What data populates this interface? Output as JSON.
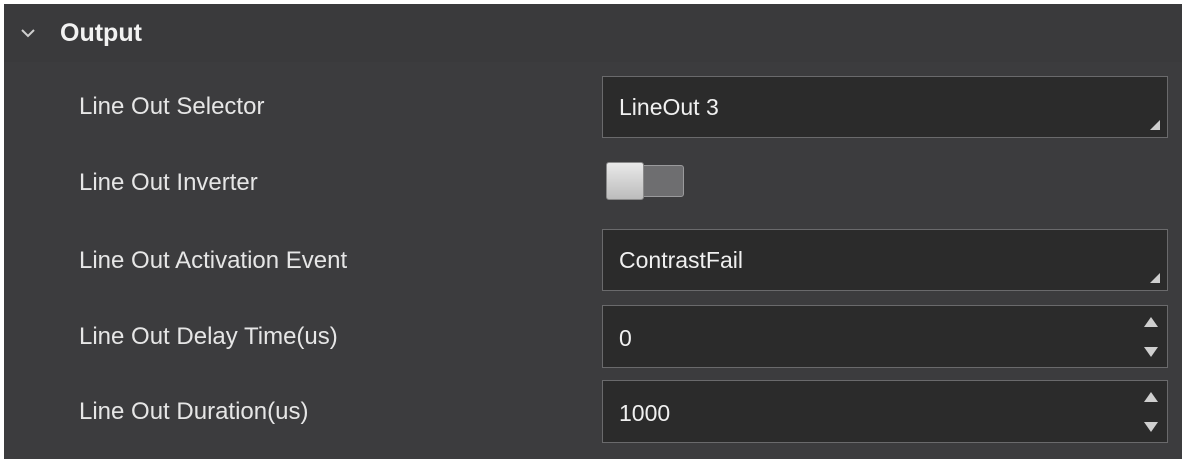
{
  "section": {
    "title": "Output",
    "expanded": true
  },
  "rows": {
    "line_out_selector": {
      "label": "Line Out Selector",
      "value": "LineOut 3"
    },
    "line_out_inverter": {
      "label": "Line Out Inverter",
      "on": false
    },
    "line_out_activation_event": {
      "label": "Line Out Activation Event",
      "value": "ContrastFail"
    },
    "line_out_delay_time": {
      "label": "Line Out Delay Time(us)",
      "value": "0"
    },
    "line_out_duration": {
      "label": "Line Out Duration(us)",
      "value": "1000"
    }
  },
  "colors": {
    "panel_bg": "#3c3c3e",
    "field_bg": "#2b2b2b",
    "field_border": "#6a6a6c",
    "text": "#e6e6e6"
  },
  "icons": {
    "collapse": "chevron-down-icon",
    "dropdown": "dropdown-corner-icon",
    "spin_up": "spin-up-icon",
    "spin_down": "spin-down-icon"
  }
}
